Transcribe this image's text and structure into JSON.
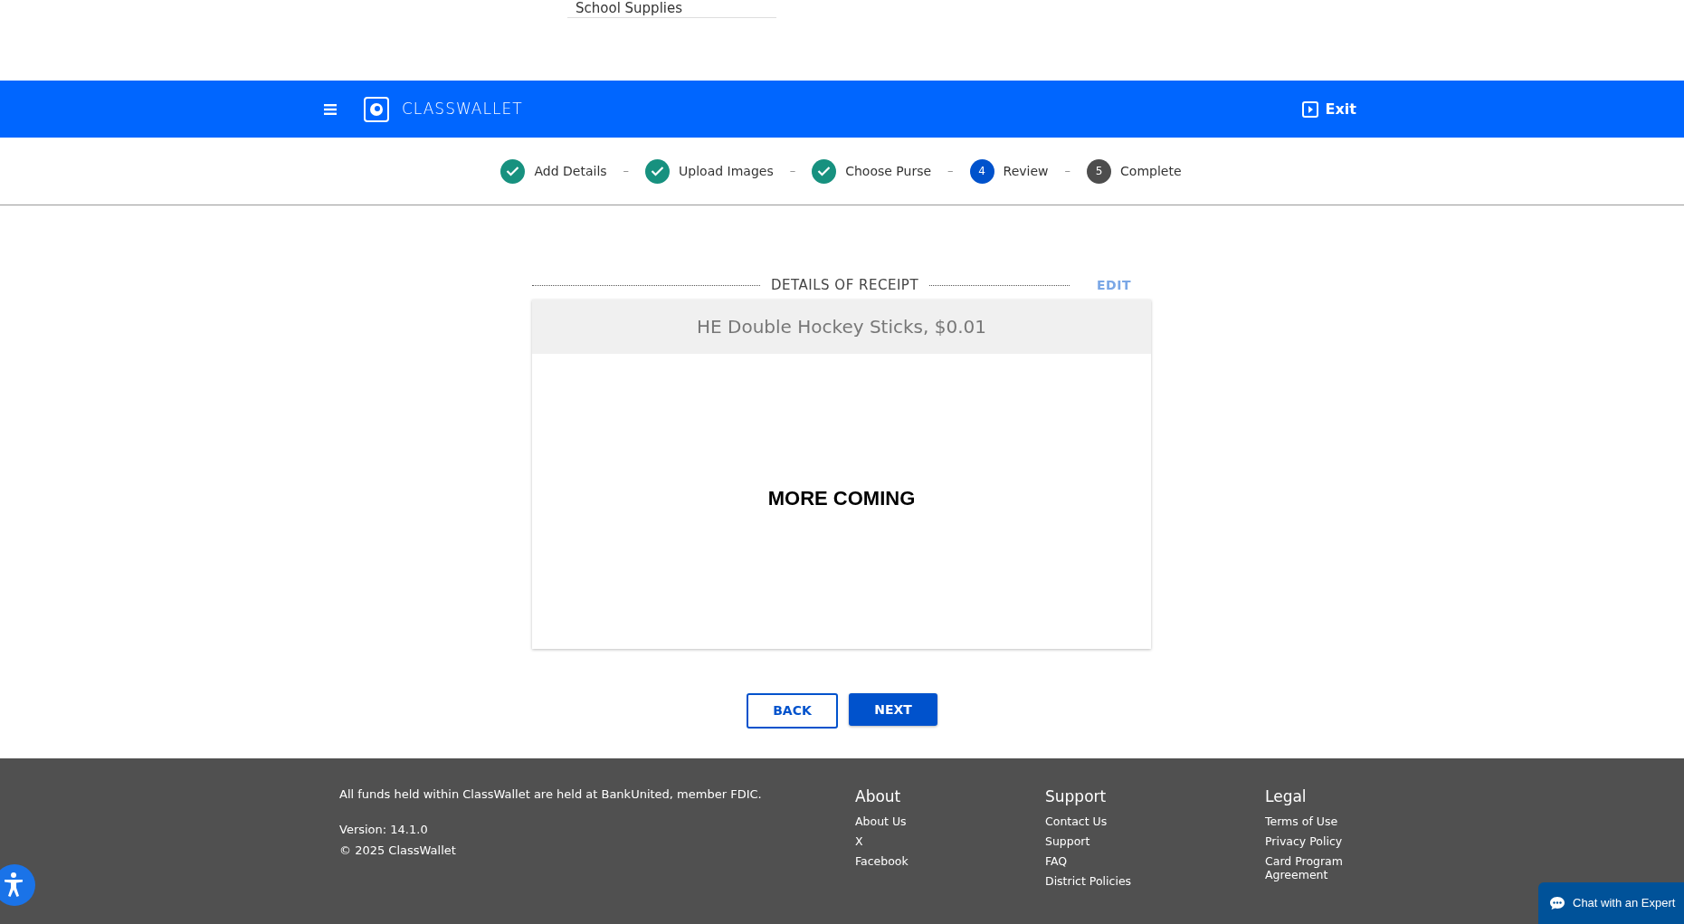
{
  "top_field": {
    "value": "School Supplies"
  },
  "header": {
    "brand": "CLASSWALLET",
    "exit": "Exit"
  },
  "steps": [
    {
      "label": "Add Details",
      "kind": "done"
    },
    {
      "label": "Upload Images",
      "kind": "done"
    },
    {
      "label": "Choose Purse",
      "kind": "done"
    },
    {
      "label": "Review",
      "kind": "current",
      "number": "4"
    },
    {
      "label": "Complete",
      "kind": "pending",
      "number": "5"
    }
  ],
  "step_separator": "–",
  "receipt": {
    "section_title": "DETAILS OF RECEIPT",
    "edit": "EDIT",
    "item": "HE Double Hockey Sticks, $0.01",
    "body": "MORE COMING"
  },
  "buttons": {
    "back": "BACK",
    "next": "NEXT"
  },
  "footer": {
    "notice": "All funds held within ClassWallet are held at BankUnited, member FDIC.",
    "version": "Version: 14.1.0",
    "copyright": "© 2025 ClassWallet",
    "columns": [
      {
        "title": "About",
        "links": [
          "About Us",
          "X",
          "Facebook"
        ]
      },
      {
        "title": "Support",
        "links": [
          "Contact Us",
          "Support",
          "FAQ",
          "District Policies"
        ]
      },
      {
        "title": "Legal",
        "links": [
          "Terms of Use",
          "Privacy Policy",
          "Card Program Agreement"
        ]
      }
    ]
  },
  "chat": {
    "label": "Chat with an Expert"
  }
}
